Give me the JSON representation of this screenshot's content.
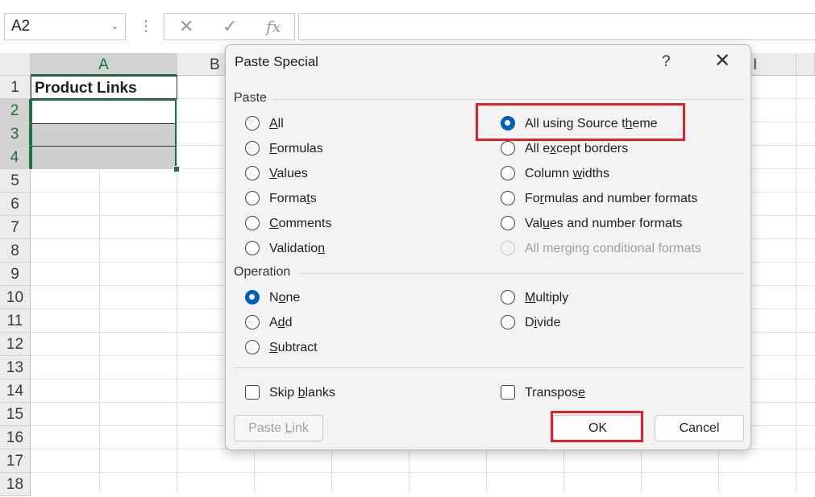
{
  "formula_bar": {
    "name_box": "A2",
    "dropdown_glyph": "⌄",
    "dots_glyph": "⋮",
    "cancel_icon": "✕",
    "enter_icon": "✓",
    "fx_label": "fx",
    "formula_value": ""
  },
  "sheet": {
    "columns": [
      "A",
      "B",
      "I"
    ],
    "rows": [
      "1",
      "2",
      "3",
      "4",
      "5",
      "6",
      "7",
      "8",
      "9",
      "10",
      "11",
      "12",
      "13",
      "14",
      "15",
      "16",
      "17",
      "18"
    ],
    "cell_a1": "Product Links",
    "selection_color": "#1e7145"
  },
  "dialog": {
    "title": "Paste Special",
    "help": "?",
    "close": "✕",
    "paste_group": "Paste",
    "paste_left": [
      {
        "pre": "",
        "key": "A",
        "post": "ll",
        "checked": false
      },
      {
        "pre": "",
        "key": "F",
        "post": "ormulas",
        "checked": false
      },
      {
        "pre": "",
        "key": "V",
        "post": "alues",
        "checked": false
      },
      {
        "pre": "Forma",
        "key": "t",
        "post": "s",
        "checked": false
      },
      {
        "pre": "",
        "key": "C",
        "post": "omments",
        "checked": false
      },
      {
        "pre": "Validatio",
        "key": "n",
        "post": "",
        "checked": false
      }
    ],
    "paste_right": [
      {
        "pre": "All using Source t",
        "key": "h",
        "post": "eme",
        "checked": true
      },
      {
        "pre": "All e",
        "key": "x",
        "post": "cept borders",
        "checked": false
      },
      {
        "pre": "Column ",
        "key": "w",
        "post": "idths",
        "checked": false
      },
      {
        "pre": "Fo",
        "key": "r",
        "post": "mulas and number formats",
        "checked": false
      },
      {
        "pre": "Val",
        "key": "u",
        "post": "es and number formats",
        "checked": false
      },
      {
        "pre": "All mergin",
        "key": "g",
        "post": " conditional formats",
        "checked": false,
        "disabled": true
      }
    ],
    "operation_group": "Operation",
    "operation_left": [
      {
        "pre": "N",
        "key": "o",
        "post": "ne",
        "checked": true
      },
      {
        "pre": "A",
        "key": "d",
        "post": "d",
        "checked": false
      },
      {
        "pre": "",
        "key": "S",
        "post": "ubtract",
        "checked": false
      }
    ],
    "operation_right": [
      {
        "pre": "",
        "key": "M",
        "post": "ultiply",
        "checked": false
      },
      {
        "pre": "D",
        "key": "i",
        "post": "vide",
        "checked": false
      }
    ],
    "skip_blanks": {
      "pre": "Skip ",
      "key": "b",
      "post": "lanks",
      "checked": false
    },
    "transpose": {
      "pre": "Transpos",
      "key": "e",
      "post": "",
      "checked": false
    },
    "paste_link": {
      "pre": "Paste ",
      "key": "L",
      "post": "ink"
    },
    "ok": "OK",
    "cancel": "Cancel",
    "highlight_color": "#e0202c",
    "accent_color": "#005fb8"
  }
}
